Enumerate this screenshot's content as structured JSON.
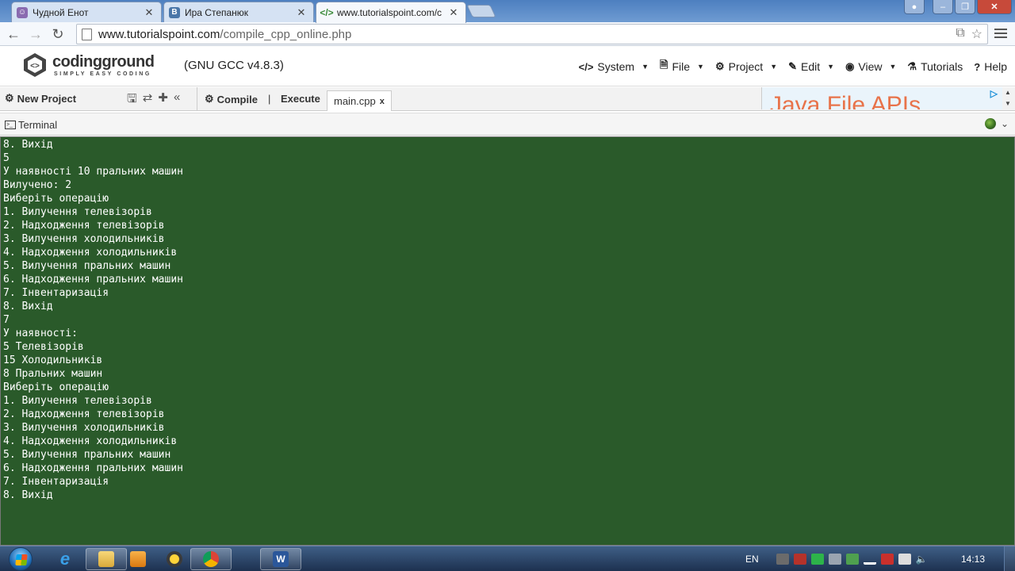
{
  "browser": {
    "tabs": [
      {
        "title": "Чудной Енот",
        "favicon": "raccoon-favicon",
        "color": "#8a6bb0"
      },
      {
        "title": "Ира Степанюк",
        "favicon": "vk-favicon",
        "color": "#4a76a8"
      },
      {
        "title": "www.tutorialspoint.com/c",
        "favicon": "code-favicon",
        "color": "#3a8a3a"
      }
    ],
    "address": {
      "host": "www.tutorialspoint.com",
      "path": "/compile_cpp_online.php"
    }
  },
  "site": {
    "logo_name": "codingground",
    "logo_tagline": "SIMPLY EASY CODING",
    "compiler": "(GNU GCC v4.8.3)",
    "menu": [
      {
        "label": "System",
        "icon": "code-icon"
      },
      {
        "label": "File",
        "icon": "file-icon"
      },
      {
        "label": "Project",
        "icon": "gear-icon"
      },
      {
        "label": "Edit",
        "icon": "edit-icon"
      },
      {
        "label": "View",
        "icon": "eye-icon"
      },
      {
        "label": "Tutorials",
        "icon": "tutorials-icon"
      },
      {
        "label": "Help",
        "icon": "help-icon"
      }
    ]
  },
  "toolbar": {
    "new_project": "New Project",
    "compile": "Compile",
    "separator": "|",
    "execute": "Execute",
    "file_tab": "main.cpp",
    "file_tab_close": "x",
    "ad_text": "Java File APIs"
  },
  "terminal": {
    "title": "Terminal",
    "background": "#2a5a2a",
    "lines": [
      "8. Вихід",
      "5",
      "У наявності 10 пральних машин",
      "Вилучено: 2",
      "Виберіть операцію",
      "1. Вилучення телевізорів",
      "2. Надходження телевізорів",
      "3. Вилучення холодильників",
      "4. Надходження холодильників",
      "5. Вилучення пральних машин",
      "6. Надходження пральних машин",
      "7. Інвентаризація",
      "8. Вихід",
      "7",
      "У наявності:",
      "5 Телевізорів",
      "15 Холодильників",
      "8 Пральних машин",
      "Виберіть операцію",
      "1. Вилучення телевізорів",
      "2. Надходження телевізорів",
      "3. Вилучення холодильників",
      "4. Надходження холодильників",
      "5. Вилучення пральних машин",
      "6. Надходження пральних машин",
      "7. Інвентаризація",
      "8. Вихід"
    ]
  },
  "taskbar": {
    "language": "EN",
    "clock": "14:13"
  }
}
